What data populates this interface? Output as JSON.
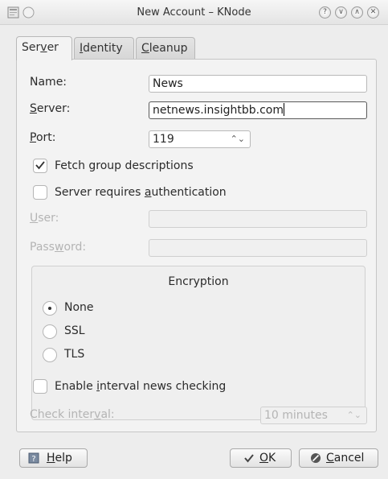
{
  "window": {
    "title": "New Account – KNode",
    "help_btn": "?",
    "min_btn": "∨",
    "max_btn": "∧",
    "close_btn": "✕"
  },
  "tabs": [
    {
      "label_pre": "Ser",
      "label_u": "v",
      "label_post": "er"
    },
    {
      "label_pre": "",
      "label_u": "I",
      "label_post": "dentity"
    },
    {
      "label_pre": "",
      "label_u": "C",
      "label_post": "leanup"
    }
  ],
  "form": {
    "name_label": "Name:",
    "name_value": "News",
    "server_label_u": "S",
    "server_label_post": "erver:",
    "server_value": "netnews.insightbb.com",
    "port_label_u": "P",
    "port_label_post": "ort:",
    "port_value": "119",
    "fetch_label": "Fetch group descriptions",
    "auth_label_pre": "Server requires ",
    "auth_label_u": "a",
    "auth_label_post": "uthentication",
    "user_label_u": "U",
    "user_label_post": "ser:",
    "password_label_pre": "Pass",
    "password_label_u": "w",
    "password_label_post": "ord:"
  },
  "encryption": {
    "title": "Encryption",
    "options": [
      "None",
      "SSL",
      "TLS"
    ],
    "selected": "None"
  },
  "interval": {
    "enable_pre": "Enable ",
    "enable_u": "i",
    "enable_post": "nterval news checking",
    "check_pre": "Check inter",
    "check_u": "v",
    "check_post": "al:",
    "value": "10 minutes"
  },
  "buttons": {
    "help_u": "H",
    "help_post": "elp",
    "ok_u": "O",
    "ok_post": "K",
    "cancel_u": "C",
    "cancel_post": "ancel"
  },
  "state": {
    "fetch_checked": true,
    "auth_checked": false,
    "interval_checked": false
  }
}
